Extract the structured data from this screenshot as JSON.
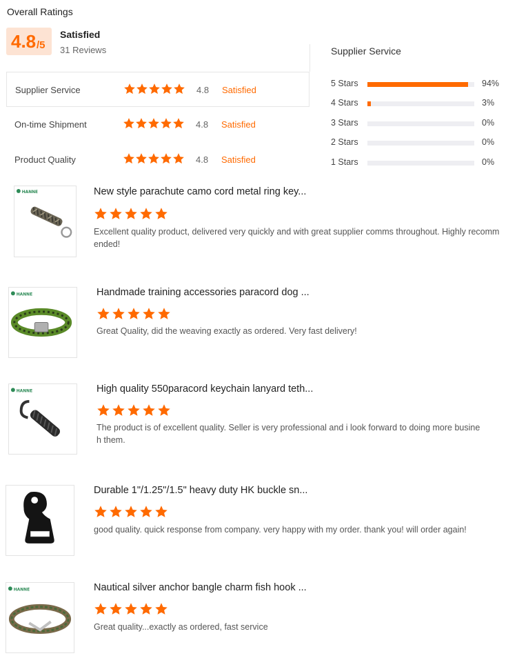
{
  "header": {
    "title": "Overall Ratings",
    "score_big": "4.8",
    "score_small": "/5",
    "satisfaction": "Satisfied",
    "review_count": "31 Reviews"
  },
  "ratings": [
    {
      "label": "Supplier Service",
      "score": "4.8",
      "status": "Satisfied",
      "stars": 5
    },
    {
      "label": "On-time Shipment",
      "score": "4.8",
      "status": "Satisfied",
      "stars": 5
    },
    {
      "label": "Product Quality",
      "score": "4.8",
      "status": "Satisfied",
      "stars": 5
    }
  ],
  "distribution": {
    "title": "Supplier Service",
    "rows": [
      {
        "label": "5  Stars",
        "percent": "94%",
        "fraction": 0.94
      },
      {
        "label": "4  Stars",
        "percent": "3%",
        "fraction": 0.03
      },
      {
        "label": "3  Stars",
        "percent": "0%",
        "fraction": 0
      },
      {
        "label": "2  Stars",
        "percent": "0%",
        "fraction": 0
      },
      {
        "label": "1  Stars",
        "percent": "0%",
        "fraction": 0
      }
    ]
  },
  "reviews": [
    {
      "title": "New style parachute camo cord metal ring key...",
      "stars": 5,
      "text": "Excellent quality product, delivered very quickly and with great supplier comms throughout. Highly recomm\nended!",
      "image": "camo-keychain-image"
    },
    {
      "title": "Handmade training accessories paracord dog ...",
      "stars": 5,
      "text": "Great Quality, did the weaving exactly as ordered. Very fast delivery!",
      "image": "green-paracord-collar-image"
    },
    {
      "title": "High quality 550paracord keychain lanyard teth...",
      "stars": 5,
      "text": "The product is of excellent quality. Seller is very professional and i look forward to doing more busine\nh them.",
      "image": "black-paracord-lanyard-image"
    },
    {
      "title": "Durable 1\"/1.25\"/1.5\" heavy duty HK buckle sn...",
      "stars": 5,
      "text": "good quality. quick response from company. very happy with my order. thank you! will order again!",
      "image": "hk-buckle-snap-image"
    },
    {
      "title": "Nautical silver anchor bangle charm fish hook ...",
      "stars": 5,
      "text": "Great quality...exactly as ordered, fast service",
      "image": "anchor-bracelet-image"
    }
  ],
  "colors": {
    "accent": "#ff6a00",
    "score_bg": "#fde3d3",
    "bar_bg": "#eeeef2"
  },
  "brand_logo_text": "HANNE"
}
